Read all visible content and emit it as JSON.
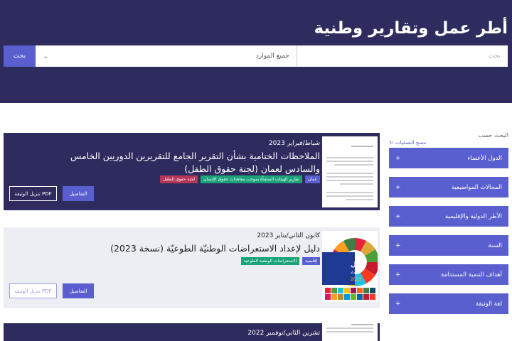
{
  "page": {
    "title": "أطر عمل وتقارير وطنية"
  },
  "search": {
    "button": "بحث",
    "placeholder": "بحث",
    "select_value": "جميع الموارد"
  },
  "filters": {
    "heading": "البحث حسب",
    "reset": "مسح التصفيات",
    "items": [
      {
        "label": "الدول الأعضاء"
      },
      {
        "label": "المجالات المواضيعية"
      },
      {
        "label": "الأطر الدولية والإقليمية"
      },
      {
        "label": "السنة"
      },
      {
        "label": "أهداف التنمية المستدامة"
      },
      {
        "label": "لغة الوثيقة"
      }
    ]
  },
  "results": [
    {
      "date": "شباط/فبراير 2023",
      "title": "الملاحظات الختامية بشأن التقرير الجامع للتقريرين الدوريين الخامس والسادس لعمان (لجنة حقوق الطفل)",
      "tags": [
        {
          "label": "عمان",
          "color": "#5a5fcf"
        },
        {
          "label": "تقارير الهيئات المنشأة بموجب معاهدات حقوق الإنسان",
          "color": "#1ca37a"
        },
        {
          "label": "لجنة حقوق الطفل",
          "color": "#b8355a"
        }
      ],
      "details": "التفاصيل",
      "download": "تنزيل الوثيقة PDF"
    },
    {
      "date": "كانون الثاني/يناير 2023",
      "title": "دليل لإعداد الاستعراضات الوطنيّة الطوعيّة (نسخة 2023)",
      "tags": [
        {
          "label": "إقليمية",
          "color": "#5a5fcf"
        },
        {
          "label": "الاستعراضات الوطنية الطوعية",
          "color": "#1ca37a"
        }
      ],
      "details": "التفاصيل",
      "download": "تنزيل الوثيقة PDF",
      "thumb_text": [
        "دليل",
        "لإعداد",
        "2023"
      ]
    },
    {
      "date": "تشرين الثاني/نوفمبر 2022"
    }
  ]
}
